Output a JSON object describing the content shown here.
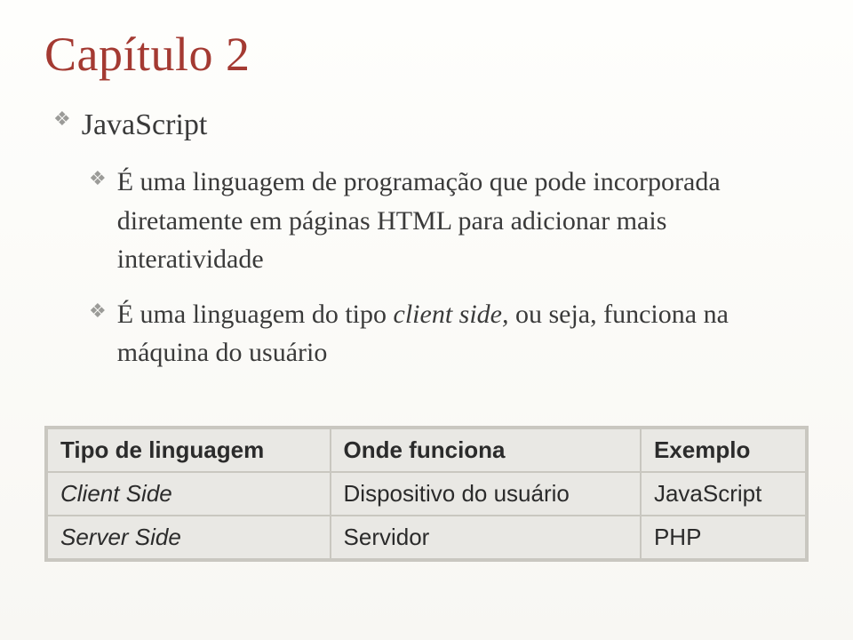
{
  "title": "Capítulo 2",
  "bullets": {
    "l1": "JavaScript",
    "l2a": "É uma linguagem de programação que pode incorporada diretamente em páginas HTML para adicionar mais interatividade",
    "l2b_pre": "É uma linguagem do tipo ",
    "l2b_italic": "client side,",
    "l2b_post": " ou seja, funciona na máquina do usuário"
  },
  "table": {
    "headers": {
      "c1": "Tipo de linguagem",
      "c2": "Onde funciona",
      "c3": "Exemplo"
    },
    "rows": [
      {
        "c1": "Client Side",
        "c2": "Dispositivo do usuário",
        "c3": "JavaScript"
      },
      {
        "c1": "Server Side",
        "c2": "Servidor",
        "c3": "PHP"
      }
    ]
  }
}
